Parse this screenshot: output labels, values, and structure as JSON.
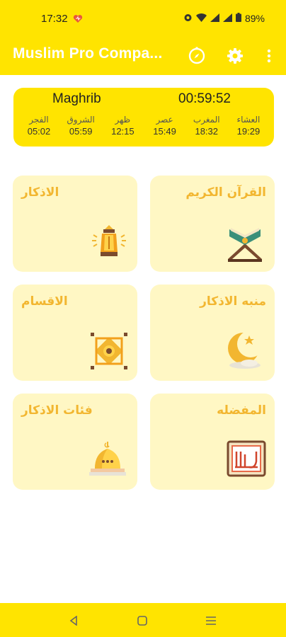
{
  "status_bar": {
    "time": "17:32",
    "battery": "89%",
    "icons": [
      "heart-icon",
      "alarm-icon",
      "wifi-icon",
      "signal-icon",
      "signal-icon",
      "battery-icon"
    ]
  },
  "app_bar": {
    "title": "Muslim Pro Compa...",
    "icons": [
      "compass-icon",
      "gear-icon",
      "more-vert-icon"
    ],
    "background": "#ffe400"
  },
  "prayer_times": {
    "current_prayer": "Maghrib",
    "countdown": "00:59:52",
    "prayers": [
      {
        "name": "الفجر",
        "time": "05:02"
      },
      {
        "name": "الشروق",
        "time": "05:59"
      },
      {
        "name": "ظهر",
        "time": "12:15"
      },
      {
        "name": "عصر",
        "time": "15:49"
      },
      {
        "name": "المغرب",
        "time": "18:32"
      },
      {
        "name": "العشاء",
        "time": "19:29"
      }
    ]
  },
  "tiles": [
    {
      "label": "القرآن الكريم",
      "icon": "quran-icon"
    },
    {
      "label": "الاذكار",
      "icon": "lantern-icon"
    },
    {
      "label": "منبه الاذكار",
      "icon": "crescent-moon-icon"
    },
    {
      "label": "الاقسام",
      "icon": "islamic-pattern-icon"
    },
    {
      "label": "المفضله",
      "icon": "allah-calligraphy-icon"
    },
    {
      "label": "فئات الاذكار",
      "icon": "mosque-dome-icon"
    }
  ],
  "colors": {
    "accent": "#ffe400",
    "tile_bg": "#fff7c4",
    "tile_text": "#f2b630"
  },
  "nav_bar": {
    "buttons": [
      "back-icon",
      "home-icon",
      "recents-icon"
    ]
  }
}
